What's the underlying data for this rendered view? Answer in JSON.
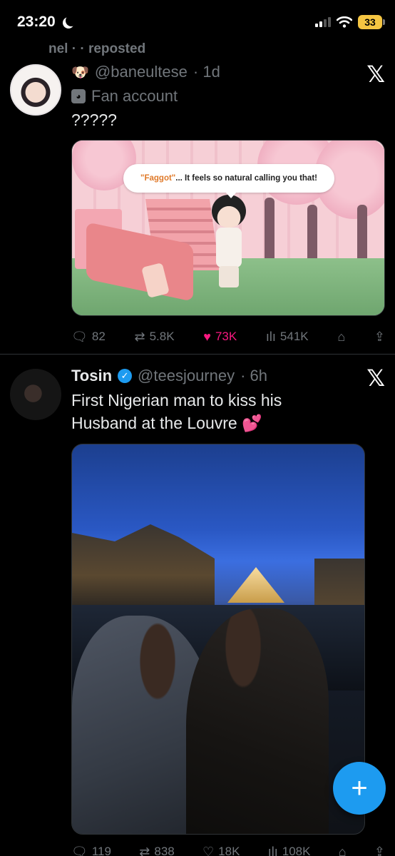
{
  "status_bar": {
    "time": "23:20",
    "battery": "33"
  },
  "repost_banner": "nel · · reposted",
  "tweets": [
    {
      "author_name": "",
      "emoji": "🐶",
      "handle": "@baneultese",
      "time": "· 1d",
      "label": "Fan account",
      "text": "?????",
      "media_caption_highlight": "\"Faggot\"",
      "media_caption_rest": "... It feels so natural calling you that!",
      "stats": {
        "replies": "82",
        "reposts": "5.8K",
        "likes": "73K",
        "views": "541K"
      }
    },
    {
      "author_name": "Tosin",
      "handle": "@teesjourney",
      "time": "· 6h",
      "text": "First Nigerian man to kiss his Husband at the Louvre 💕",
      "stats": {
        "replies": "119",
        "reposts": "838",
        "likes": "18K",
        "views": "108K"
      }
    }
  ],
  "icons": {
    "reply": "reply-icon",
    "repost": "repost-icon",
    "like": "heart-icon",
    "views": "views-icon",
    "bookmark": "bookmark-icon",
    "share": "share-icon",
    "x_logo": "x-logo-icon",
    "compose": "plus-icon"
  },
  "colors": {
    "accent": "#1d9bf0",
    "like": "#f91880",
    "muted": "#71767b",
    "battery": "#f5c542"
  }
}
